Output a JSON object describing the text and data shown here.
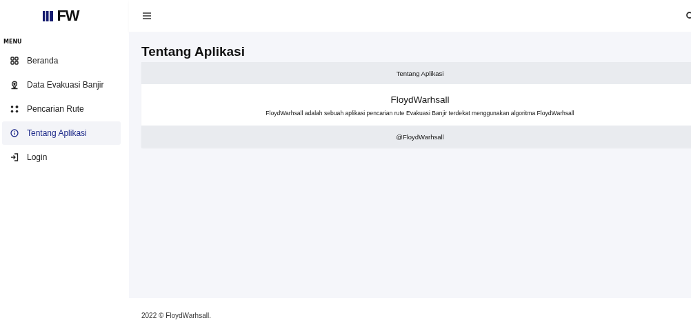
{
  "brand": {
    "name": "FW"
  },
  "sidebar": {
    "heading": "MENU",
    "items": [
      {
        "label": "Beranda",
        "selected": false
      },
      {
        "label": "Data Evakuasi Banjir",
        "selected": false
      },
      {
        "label": "Pencarian Rute",
        "selected": false
      },
      {
        "label": "Tentang Aplikasi",
        "selected": true
      },
      {
        "label": "Login",
        "selected": false
      }
    ]
  },
  "page": {
    "title": "Tentang Aplikasi"
  },
  "card": {
    "header": "Tentang Aplikasi",
    "title": "FloydWarhsall",
    "text": "FloydWarhsall adalah sebuah aplikasi pencarian rute Evakuasi Banjir terdekat menggunakan algoritma FloydWarhsall",
    "footer": "@FloydWarhsall"
  },
  "footer": {
    "text": "2022 © FloydWarhsall."
  }
}
